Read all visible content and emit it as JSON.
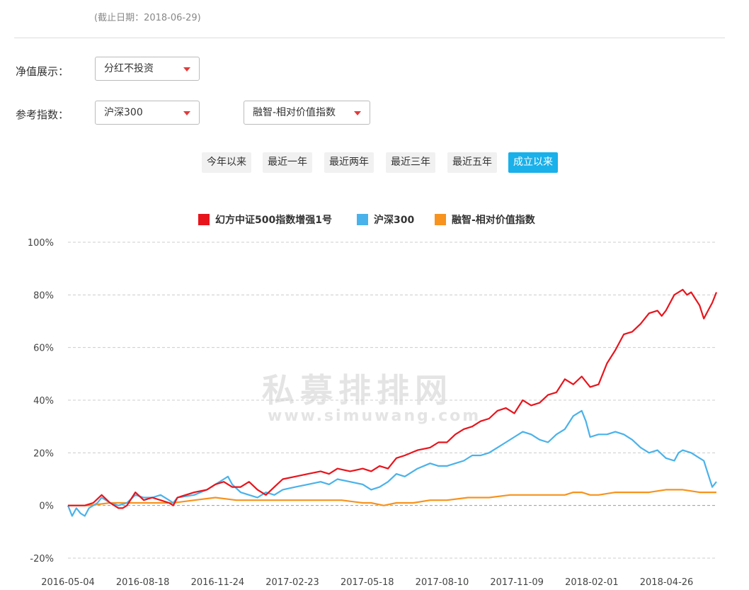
{
  "header": {
    "as_of": "(截止日期：2018-06-29)"
  },
  "filters": {
    "nav_label": "净值展示：",
    "nav_value": "分红不投资",
    "ref_label": "参考指数：",
    "ref_index_1": "沪深300",
    "ref_index_2": "融智-相对价值指数"
  },
  "period_buttons": [
    {
      "label": "今年以来",
      "active": false
    },
    {
      "label": "最近一年",
      "active": false
    },
    {
      "label": "最近两年",
      "active": false
    },
    {
      "label": "最近三年",
      "active": false
    },
    {
      "label": "最近五年",
      "active": false
    },
    {
      "label": "成立以来",
      "active": true
    }
  ],
  "watermark": {
    "main": "私募排排网",
    "sub": "www.simuwang.com"
  },
  "colors": {
    "fund": "#e8141c",
    "hs300": "#4ab2ea",
    "rongzhi": "#f7931e",
    "active_button": "#1ab0ea",
    "caret": "#e23a3a"
  },
  "chart_data": {
    "type": "line",
    "ylim": [
      -20,
      100
    ],
    "yticks": [
      "100%",
      "80%",
      "60%",
      "40%",
      "20%",
      "0%",
      "-20%"
    ],
    "ytick_values": [
      100,
      80,
      60,
      40,
      20,
      0,
      -20
    ],
    "x_tick_labels": [
      "2016-05-04",
      "2016-08-18",
      "2016-11-24",
      "2017-02-23",
      "2017-05-18",
      "2017-08-10",
      "2017-11-09",
      "2018-02-01",
      "2018-04-26"
    ],
    "x_tick_indices": [
      0,
      15,
      30,
      45,
      60,
      75,
      90,
      105,
      120
    ],
    "num_points": 131,
    "y_unit": "%",
    "grid": true,
    "legend_position": "top",
    "series": [
      {
        "name": "幻方中证500指数增强1号",
        "color": "#e8141c",
        "values": [
          [
            0,
            0
          ],
          [
            4,
            0
          ],
          [
            6,
            1
          ],
          [
            8,
            4
          ],
          [
            10,
            1
          ],
          [
            12,
            -1
          ],
          [
            13,
            -1
          ],
          [
            14,
            0
          ],
          [
            16,
            5
          ],
          [
            18,
            2
          ],
          [
            20,
            3
          ],
          [
            22,
            2
          ],
          [
            24,
            1
          ],
          [
            25,
            0
          ],
          [
            26,
            3
          ],
          [
            30,
            5
          ],
          [
            33,
            6
          ],
          [
            35,
            8
          ],
          [
            37,
            9
          ],
          [
            39,
            7
          ],
          [
            41,
            7
          ],
          [
            43,
            9
          ],
          [
            45,
            6
          ],
          [
            47,
            4
          ],
          [
            49,
            7
          ],
          [
            51,
            10
          ],
          [
            54,
            11
          ],
          [
            57,
            12
          ],
          [
            60,
            13
          ],
          [
            62,
            12
          ],
          [
            64,
            14
          ],
          [
            67,
            13
          ],
          [
            70,
            14
          ],
          [
            72,
            13
          ],
          [
            74,
            15
          ],
          [
            76,
            14
          ],
          [
            78,
            18
          ],
          [
            80,
            19
          ],
          [
            83,
            21
          ],
          [
            86,
            22
          ],
          [
            88,
            24
          ],
          [
            90,
            24
          ],
          [
            92,
            27
          ],
          [
            94,
            29
          ],
          [
            96,
            30
          ],
          [
            98,
            32
          ],
          [
            100,
            33
          ],
          [
            102,
            36
          ],
          [
            104,
            37
          ],
          [
            106,
            35
          ],
          [
            108,
            40
          ],
          [
            110,
            38
          ],
          [
            112,
            39
          ],
          [
            114,
            42
          ],
          [
            116,
            43
          ],
          [
            118,
            48
          ],
          [
            120,
            46
          ],
          [
            122,
            49
          ],
          [
            124,
            45
          ],
          [
            126,
            46
          ],
          [
            128,
            54
          ],
          [
            130,
            59
          ],
          [
            132,
            65
          ],
          [
            134,
            66
          ],
          [
            136,
            69
          ],
          [
            138,
            73
          ],
          [
            140,
            74
          ],
          [
            141,
            72
          ],
          [
            142,
            74
          ],
          [
            144,
            80
          ],
          [
            146,
            82
          ],
          [
            147,
            80
          ],
          [
            148,
            81
          ],
          [
            150,
            76
          ],
          [
            151,
            71
          ],
          [
            152,
            74
          ],
          [
            153,
            77
          ],
          [
            154,
            81
          ]
        ]
      },
      {
        "name": "沪深300",
        "color": "#4ab2ea",
        "values": [
          [
            0,
            0
          ],
          [
            1,
            -4
          ],
          [
            2,
            -1
          ],
          [
            3,
            -3
          ],
          [
            4,
            -4
          ],
          [
            5,
            -1
          ],
          [
            6,
            0
          ],
          [
            7,
            1
          ],
          [
            8,
            3
          ],
          [
            10,
            1
          ],
          [
            12,
            0
          ],
          [
            14,
            1
          ],
          [
            16,
            4
          ],
          [
            18,
            3
          ],
          [
            20,
            3
          ],
          [
            22,
            4
          ],
          [
            24,
            2
          ],
          [
            25,
            1
          ],
          [
            26,
            3
          ],
          [
            30,
            4
          ],
          [
            33,
            6
          ],
          [
            35,
            8
          ],
          [
            37,
            10
          ],
          [
            38,
            11
          ],
          [
            39,
            8
          ],
          [
            41,
            5
          ],
          [
            43,
            4
          ],
          [
            45,
            3
          ],
          [
            47,
            5
          ],
          [
            49,
            4
          ],
          [
            51,
            6
          ],
          [
            54,
            7
          ],
          [
            57,
            8
          ],
          [
            60,
            9
          ],
          [
            62,
            8
          ],
          [
            64,
            10
          ],
          [
            67,
            9
          ],
          [
            70,
            8
          ],
          [
            72,
            6
          ],
          [
            74,
            7
          ],
          [
            76,
            9
          ],
          [
            78,
            12
          ],
          [
            80,
            11
          ],
          [
            83,
            14
          ],
          [
            86,
            16
          ],
          [
            88,
            15
          ],
          [
            90,
            15
          ],
          [
            92,
            16
          ],
          [
            94,
            17
          ],
          [
            96,
            19
          ],
          [
            98,
            19
          ],
          [
            100,
            20
          ],
          [
            102,
            22
          ],
          [
            104,
            24
          ],
          [
            106,
            26
          ],
          [
            108,
            28
          ],
          [
            110,
            27
          ],
          [
            112,
            25
          ],
          [
            114,
            24
          ],
          [
            116,
            27
          ],
          [
            118,
            29
          ],
          [
            120,
            34
          ],
          [
            122,
            36
          ],
          [
            123,
            32
          ],
          [
            124,
            26
          ],
          [
            126,
            27
          ],
          [
            128,
            27
          ],
          [
            130,
            28
          ],
          [
            132,
            27
          ],
          [
            134,
            25
          ],
          [
            136,
            22
          ],
          [
            138,
            20
          ],
          [
            140,
            21
          ],
          [
            142,
            18
          ],
          [
            144,
            17
          ],
          [
            145,
            20
          ],
          [
            146,
            21
          ],
          [
            148,
            20
          ],
          [
            150,
            18
          ],
          [
            151,
            17
          ],
          [
            152,
            12
          ],
          [
            153,
            7
          ],
          [
            154,
            9
          ]
        ]
      },
      {
        "name": "融智-相对价值指数",
        "color": "#f7931e",
        "values": [
          [
            0,
            0
          ],
          [
            5,
            0
          ],
          [
            10,
            1
          ],
          [
            15,
            1
          ],
          [
            20,
            1
          ],
          [
            25,
            1
          ],
          [
            30,
            2
          ],
          [
            35,
            3
          ],
          [
            40,
            2
          ],
          [
            45,
            2
          ],
          [
            50,
            2
          ],
          [
            55,
            2
          ],
          [
            60,
            2
          ],
          [
            65,
            2
          ],
          [
            70,
            1
          ],
          [
            72,
            1
          ],
          [
            75,
            0
          ],
          [
            78,
            1
          ],
          [
            82,
            1
          ],
          [
            86,
            2
          ],
          [
            90,
            2
          ],
          [
            95,
            3
          ],
          [
            100,
            3
          ],
          [
            105,
            4
          ],
          [
            110,
            4
          ],
          [
            115,
            4
          ],
          [
            118,
            4
          ],
          [
            120,
            5
          ],
          [
            122,
            5
          ],
          [
            124,
            4
          ],
          [
            126,
            4
          ],
          [
            130,
            5
          ],
          [
            134,
            5
          ],
          [
            138,
            5
          ],
          [
            142,
            6
          ],
          [
            146,
            6
          ],
          [
            150,
            5
          ],
          [
            154,
            5
          ]
        ]
      }
    ]
  }
}
